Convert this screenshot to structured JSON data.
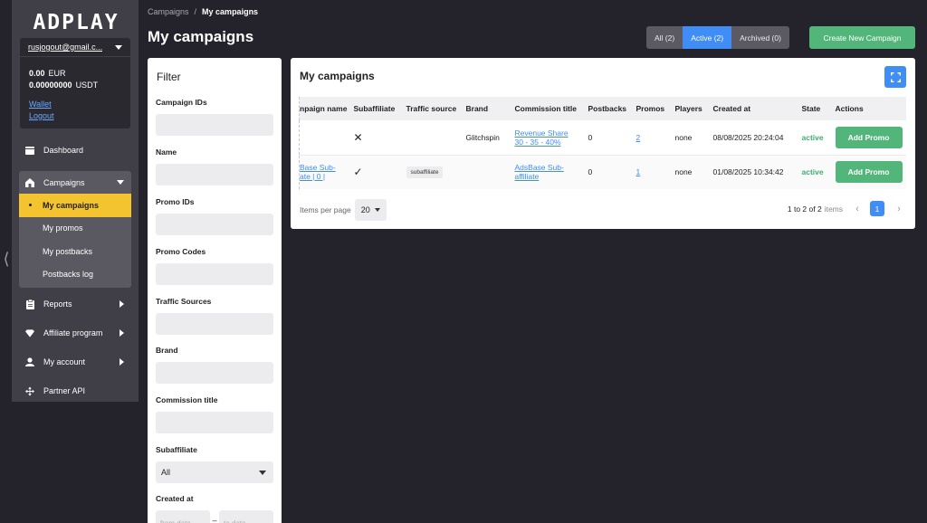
{
  "sidebar": {
    "logo": "ADPLAY",
    "account": {
      "email": "rusjogout@gmail.c...",
      "balances": [
        {
          "amount": "0.00",
          "currency": "EUR"
        },
        {
          "amount": "0.00000000",
          "currency": "USDT"
        }
      ],
      "wallet_link": "Wallet",
      "logout_link": "Logout"
    },
    "nav": {
      "dashboard": "Dashboard",
      "campaigns": "Campaigns",
      "sub": {
        "my_campaigns": "My campaigns",
        "my_promos": "My promos",
        "my_postbacks": "My postbacks",
        "postbacks_log": "Postbacks log"
      },
      "reports": "Reports",
      "affiliate_program": "Affiliate program",
      "my_account": "My account",
      "partner_api": "Partner API"
    }
  },
  "breadcrumb": {
    "parent": "Campaigns",
    "separator": "/",
    "current": "My campaigns"
  },
  "page_title": "My campaigns",
  "tabs": {
    "all": "All (2)",
    "active": "Active (2)",
    "archived": "Archived (0)"
  },
  "create_button": "Create New Campaign",
  "filter": {
    "title": "Filter",
    "labels": {
      "campaign_ids": "Campaign IDs",
      "name": "Name",
      "promo_ids": "Promo IDs",
      "promo_codes": "Promo Codes",
      "traffic_sources": "Traffic Sources",
      "brand": "Brand",
      "commission_title": "Commission title",
      "subaffiliate": "Subaffiliate",
      "created_at": "Created at"
    },
    "subaffiliate_value": "All",
    "date_from_placeholder": "from date",
    "date_sep": "–",
    "date_to_placeholder": "to date"
  },
  "panel": {
    "title": "My campaigns",
    "columns": [
      "npaign name",
      "Subaffiliate",
      "Traffic source",
      "Brand",
      "Commission title",
      "Postbacks",
      "Promos",
      "Players",
      "Created at",
      "State",
      "Actions"
    ],
    "rows": [
      {
        "name_line1": "",
        "name_line2": "",
        "subaffiliate": "✕",
        "traffic_source": "",
        "brand": "Glitchspin",
        "commission_line1": "Revenue Share",
        "commission_line2": "30 - 35 - 40%",
        "postbacks": "0",
        "promos": "2",
        "players": "none",
        "created_at": "08/08/2025 20:24:04",
        "state": "active",
        "action": "Add Promo"
      },
      {
        "name_line1": "Base Sub-",
        "name_line2": "ate | 0 |",
        "subaffiliate": "✓",
        "traffic_source": "subaffiliate",
        "brand": "",
        "commission_line1": "AdsBase Sub-",
        "commission_line2": "affiliate",
        "postbacks": "0",
        "promos": "1",
        "players": "none",
        "created_at": "01/08/2025 10:34:42",
        "state": "active",
        "action": "Add Promo"
      }
    ],
    "items_per_page_label": "Items per page",
    "items_per_page_value": "20",
    "range_text": "1 to 2 of 2",
    "items_suffix": "items",
    "current_page": "1"
  },
  "colors": {
    "accent": "#3f8df5",
    "success": "#52b67b",
    "active_nav": "#f4c430",
    "background": "#24232b"
  }
}
